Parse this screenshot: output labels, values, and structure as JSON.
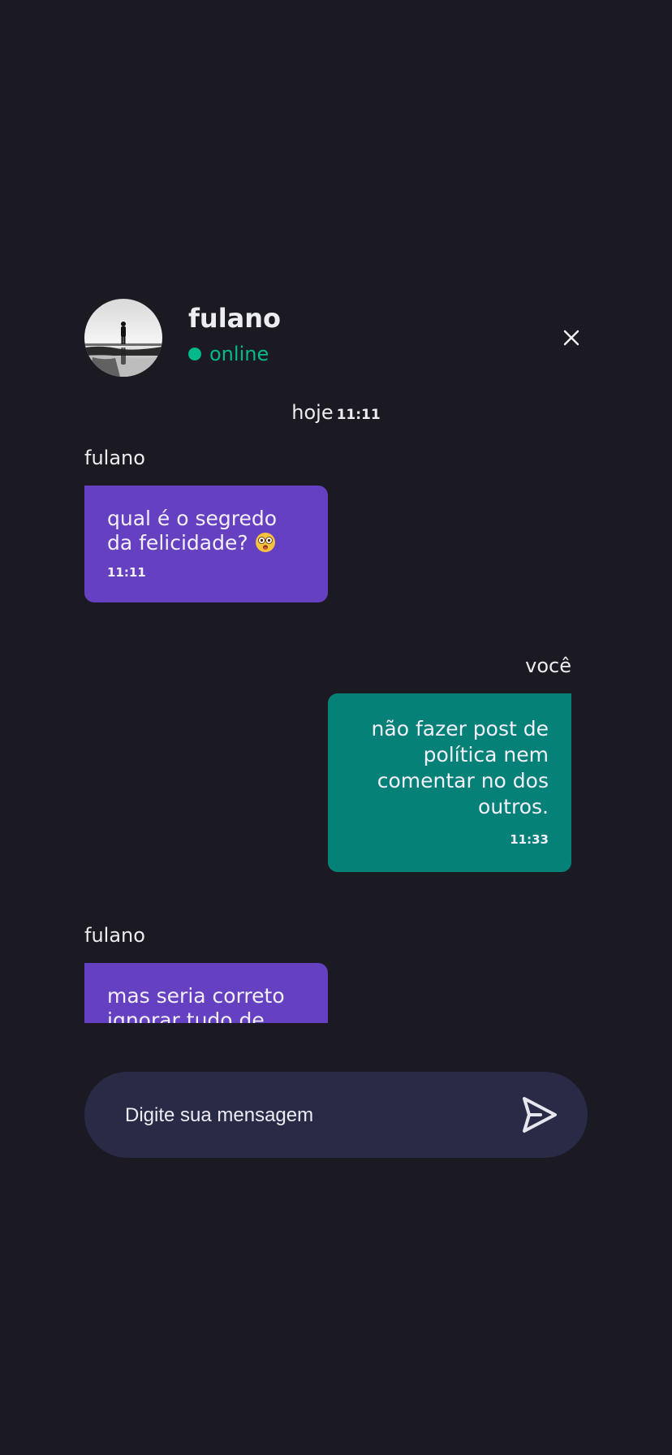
{
  "header": {
    "contact_name": "fulano",
    "status_text": "online",
    "status_color": "#04b98a",
    "avatar_icon": "person-silhouette-photo",
    "close_icon": "close-icon"
  },
  "date_divider": {
    "label": "hoje",
    "time": "11:11"
  },
  "messages": [
    {
      "direction": "incoming",
      "sender": "fulano",
      "text": "qual é o segredo da felicidade?",
      "emoji": "dizzy-face-emoji",
      "time": "11:11"
    },
    {
      "direction": "outgoing",
      "sender": "você",
      "text": "não fazer post de política nem comentar no dos outros.",
      "time": "11:33"
    },
    {
      "direction": "incoming",
      "sender": "fulano",
      "text": "mas seria correto ignorar tudo de"
    }
  ],
  "composer": {
    "placeholder": "Digite sua mensagem",
    "value": "",
    "send_icon": "send-icon"
  },
  "colors": {
    "background": "#1b1922",
    "incoming_bubble": "#6540c0",
    "outgoing_bubble": "#068178",
    "composer_background": "#292a45",
    "online": "#04b98a"
  }
}
